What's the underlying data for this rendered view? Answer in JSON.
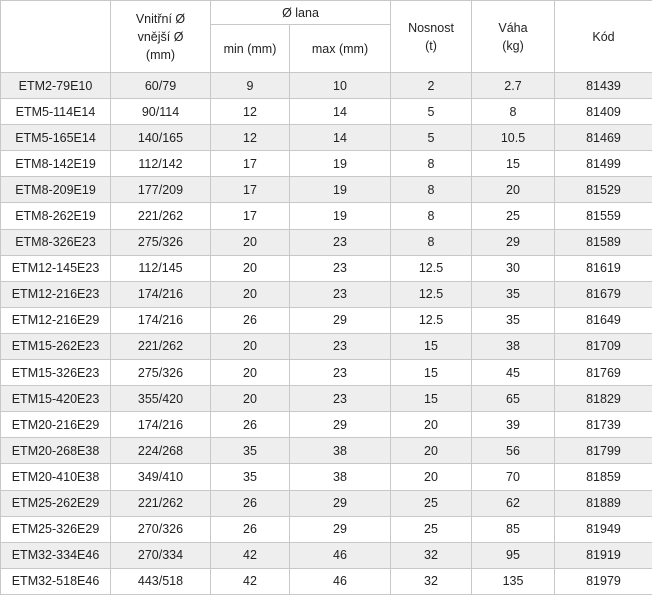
{
  "header": {
    "inner_outer": [
      "Vnitřní Ø",
      "vnější Ø",
      "(mm)"
    ],
    "rope_group": "Ø lana",
    "rope_min": "min (mm)",
    "rope_max": "max (mm)",
    "capacity": [
      "Nosnost",
      "(t)"
    ],
    "weight": [
      "Váha",
      "(kg)"
    ],
    "code": "Kód"
  },
  "rows": [
    [
      "ETM2-79E10",
      "60/79",
      "9",
      "10",
      "2",
      "2.7",
      "81439"
    ],
    [
      "ETM5-114E14",
      "90/114",
      "12",
      "14",
      "5",
      "8",
      "81409"
    ],
    [
      "ETM5-165E14",
      "140/165",
      "12",
      "14",
      "5",
      "10.5",
      "81469"
    ],
    [
      "ETM8-142E19",
      "112/142",
      "17",
      "19",
      "8",
      "15",
      "81499"
    ],
    [
      "ETM8-209E19",
      "177/209",
      "17",
      "19",
      "8",
      "20",
      "81529"
    ],
    [
      "ETM8-262E19",
      "221/262",
      "17",
      "19",
      "8",
      "25",
      "81559"
    ],
    [
      "ETM8-326E23",
      "275/326",
      "20",
      "23",
      "8",
      "29",
      "81589"
    ],
    [
      "ETM12-145E23",
      "112/145",
      "20",
      "23",
      "12.5",
      "30",
      "81619"
    ],
    [
      "ETM12-216E23",
      "174/216",
      "20",
      "23",
      "12.5",
      "35",
      "81679"
    ],
    [
      "ETM12-216E29",
      "174/216",
      "26",
      "29",
      "12.5",
      "35",
      "81649"
    ],
    [
      "ETM15-262E23",
      "221/262",
      "20",
      "23",
      "15",
      "38",
      "81709"
    ],
    [
      "ETM15-326E23",
      "275/326",
      "20",
      "23",
      "15",
      "45",
      "81769"
    ],
    [
      "ETM15-420E23",
      "355/420",
      "20",
      "23",
      "15",
      "65",
      "81829"
    ],
    [
      "ETM20-216E29",
      "174/216",
      "26",
      "29",
      "20",
      "39",
      "81739"
    ],
    [
      "ETM20-268E38",
      "224/268",
      "35",
      "38",
      "20",
      "56",
      "81799"
    ],
    [
      "ETM20-410E38",
      "349/410",
      "35",
      "38",
      "20",
      "70",
      "81859"
    ],
    [
      "ETM25-262E29",
      "221/262",
      "26",
      "29",
      "25",
      "62",
      "81889"
    ],
    [
      "ETM25-326E29",
      "270/326",
      "26",
      "29",
      "25",
      "85",
      "81949"
    ],
    [
      "ETM32-334E46",
      "270/334",
      "42",
      "46",
      "32",
      "95",
      "81919"
    ],
    [
      "ETM32-518E46",
      "443/518",
      "42",
      "46",
      "32",
      "135",
      "81979"
    ]
  ]
}
